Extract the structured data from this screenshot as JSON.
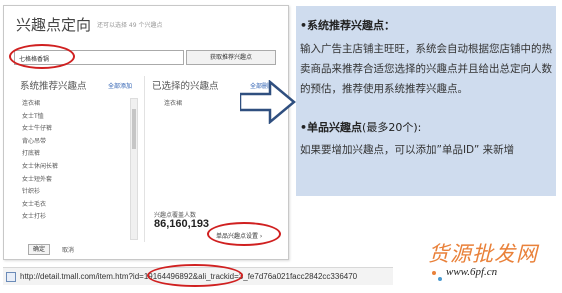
{
  "dialog": {
    "title": "兴趣点定向",
    "subtitle": "还可以选择 49 个兴趣点",
    "search_value": "七格格香锅",
    "search_button": "获取推荐兴趣点",
    "recommended_header": "系统推荐兴趣点",
    "add_all_link": "全部添加",
    "selected_header": "已选择的兴趣点",
    "remove_all_link": "全部删除",
    "recommended_items": [
      "连衣裙",
      "女士T恤",
      "女士牛仔裤",
      "背心吊带",
      "打底裤",
      "女士休闲长裤",
      "女士短外套",
      "针织衫",
      "女士毛衣",
      "女士打衫"
    ],
    "selected_items": [
      "连衣裙"
    ],
    "estimate_label": "兴趣点覆盖人数",
    "estimate_value": "86,160,193",
    "settings_button": "单品兴趣点设置 ›",
    "ok_button": "确定",
    "cancel_button": "取消"
  },
  "info": {
    "heading1": "•系统推荐兴趣点：",
    "paragraph1": "输入广告主店铺主旺旺，系统会自动根据您店铺中的热卖商品来推荐合适您选择的兴趣点并且给出总定向人数的预估，推荐使用系统推荐兴趣点。",
    "heading2_bold": "•单品兴趣点",
    "heading2_rest": "(最多20个):",
    "paragraph2": "如果要增加兴趣点，可以添加”单品ID” 来新增"
  },
  "urlbar": {
    "url": "http://detail.tmall.com/item.htm?id=19164496892&ali_trackid=3_fe7d76a021facc2842cc336470"
  },
  "watermark": {
    "title": "货源批发网",
    "url": "www.6pf.cn"
  },
  "colors": {
    "accent_red": "#d02020",
    "panel_blue": "#cfdcee",
    "link_blue": "#2a5db0",
    "watermark_orange": "#e9813a"
  }
}
